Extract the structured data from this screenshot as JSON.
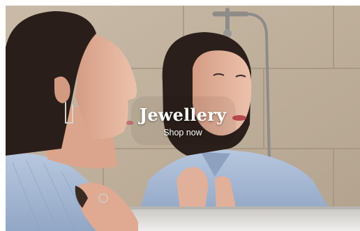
{
  "banner": {
    "title": "Jewellery",
    "cta_label": "Shop now"
  },
  "colors": {
    "tile_wall": "#c4b5a2",
    "grout": "#a89883",
    "hair": "#2a1e1a",
    "skin": "#e4b29c",
    "shirt": "#a8bbd6",
    "mirror_frame": "#d9d6d3",
    "text": "#ffffff"
  }
}
